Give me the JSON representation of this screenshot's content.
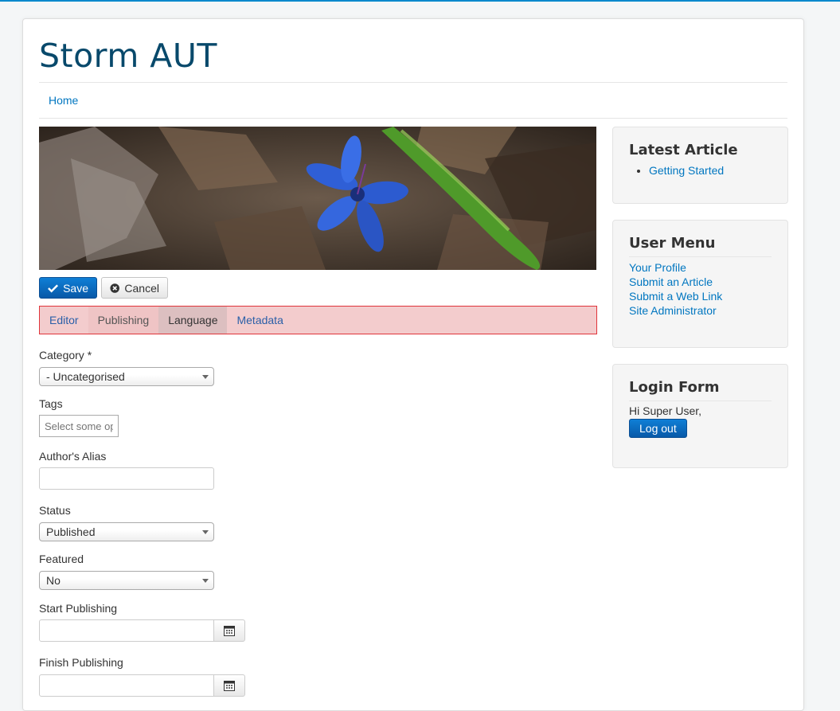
{
  "site": {
    "title": "Storm AUT"
  },
  "nav": {
    "home": "Home"
  },
  "toolbar": {
    "save_label": "Save",
    "cancel_label": "Cancel"
  },
  "tabs": [
    {
      "label": "Editor"
    },
    {
      "label": "Publishing"
    },
    {
      "label": "Language"
    },
    {
      "label": "Metadata"
    }
  ],
  "form": {
    "category_label": "Category *",
    "category_value": "- Uncategorised",
    "tags_label": "Tags",
    "tags_placeholder": "Select some op",
    "alias_label": "Author's Alias",
    "status_label": "Status",
    "status_value": "Published",
    "featured_label": "Featured",
    "featured_value": "No",
    "start_label": "Start Publishing",
    "finish_label": "Finish Publishing"
  },
  "sidebar": {
    "latest": {
      "title": "Latest Article",
      "items": [
        "Getting Started"
      ]
    },
    "usermenu": {
      "title": "User Menu",
      "items": [
        "Your Profile",
        "Submit an Article",
        "Submit a Web Link",
        "Site Administrator"
      ]
    },
    "login": {
      "title": "Login Form",
      "greeting": "Hi Super User,",
      "logout": "Log out"
    }
  },
  "colors": {
    "accent": "#0088cc",
    "title": "#08496b",
    "link": "#0076c0",
    "tabs_highlight": "#f3cccd",
    "tabs_border": "#e0343a"
  },
  "icons": {
    "save": "check-icon",
    "cancel": "cancel-circle-icon",
    "calendar": "calendar-icon"
  }
}
